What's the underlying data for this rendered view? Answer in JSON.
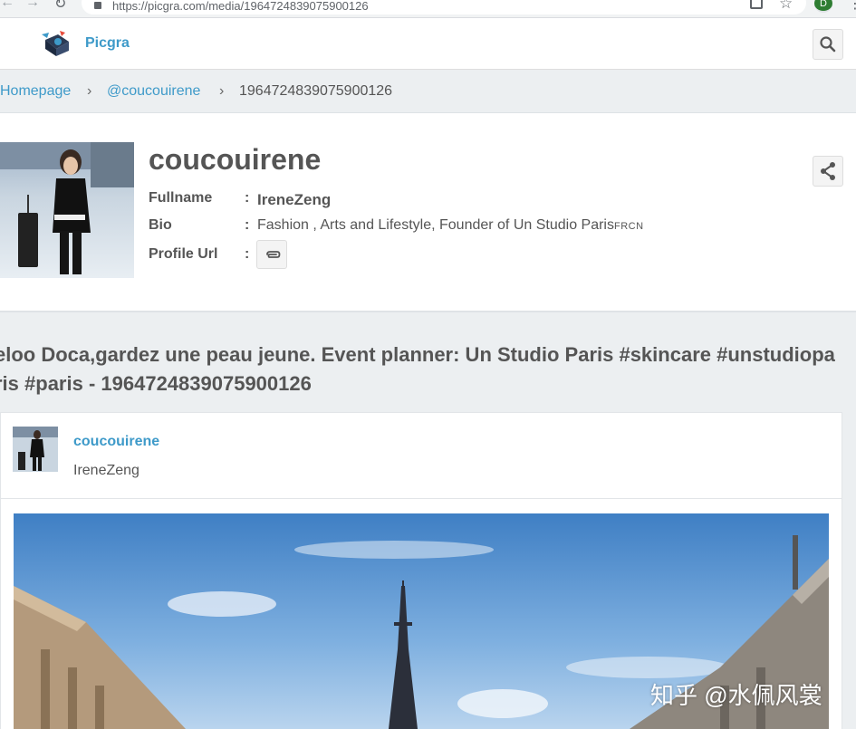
{
  "browser": {
    "url": "https://picgra.com/media/1964724839075900126",
    "profile_initial": "D"
  },
  "header": {
    "brand": "Picgra"
  },
  "breadcrumb": {
    "items": [
      "Homepage",
      "@coucouirene",
      "1964724839075900126"
    ],
    "separator": "›"
  },
  "profile": {
    "username": "coucouirene",
    "fields": {
      "fullname_label": "Fullname",
      "fullname_value": "IreneZeng",
      "bio_label": "Bio",
      "bio_value": "Fashion , Arts and Lifestyle, Founder of Un Studio Paris",
      "bio_suffix": "FRCN",
      "url_label": "Profile Url",
      "colon": ":"
    }
  },
  "media": {
    "title": "eloo Doca,gardez une peau jeune. Event planner: Un Studio Paris #skincare #unstudioparis #paris - 1964724839075900126",
    "author_username": "coucouirene",
    "author_fullname": "IreneZeng",
    "watermark": "知乎 @水佩风裳"
  },
  "colors": {
    "accent": "#3e9ac9",
    "text": "#555555",
    "page_bg": "#eceff1"
  }
}
